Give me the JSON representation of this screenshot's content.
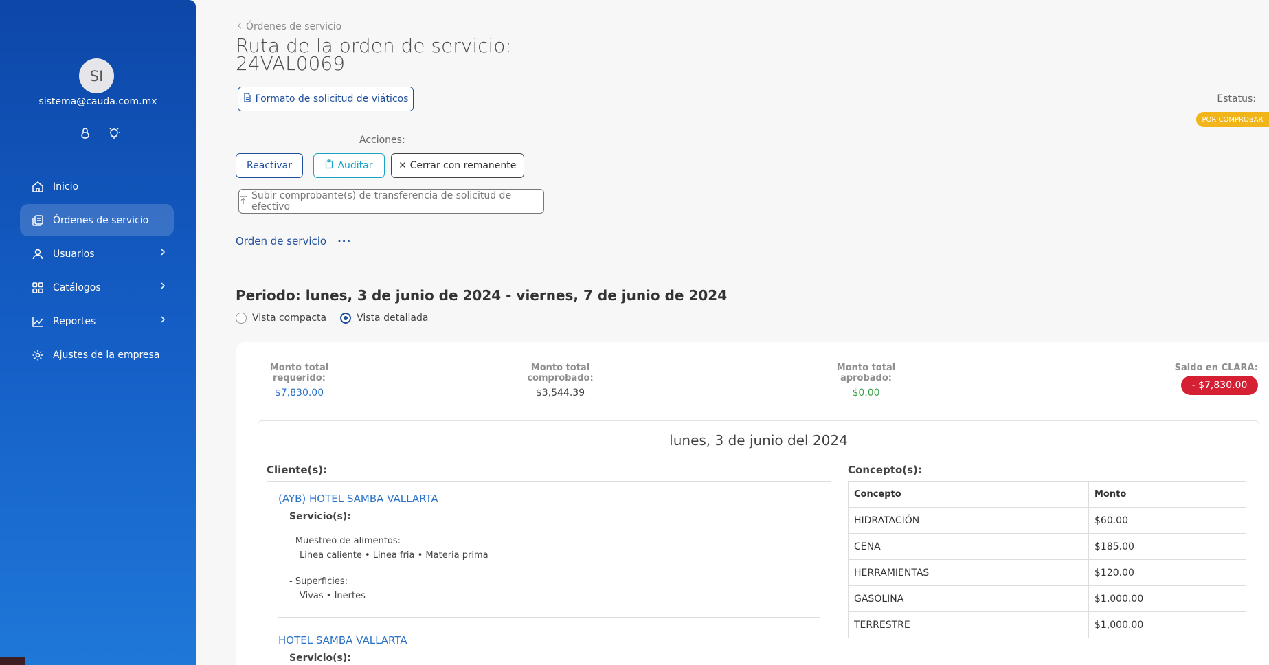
{
  "sidebar": {
    "avatar_initials": "SI",
    "email": "sistema@cauda.com.mx",
    "user_icons": [
      "lock-icon",
      "lightbulb-icon"
    ],
    "items": [
      {
        "label": "Inicio",
        "icon": "home-icon",
        "active": false,
        "has_submenu": false
      },
      {
        "label": "Órdenes de servicio",
        "icon": "orders-icon",
        "active": true,
        "has_submenu": false
      },
      {
        "label": "Usuarios",
        "icon": "user-icon",
        "active": false,
        "has_submenu": true
      },
      {
        "label": "Catálogos",
        "icon": "grid-icon",
        "active": false,
        "has_submenu": true
      },
      {
        "label": "Reportes",
        "icon": "chart-icon",
        "active": false,
        "has_submenu": true
      },
      {
        "label": "Ajustes de la empresa",
        "icon": "gear-icon",
        "active": false,
        "has_submenu": false
      }
    ]
  },
  "header": {
    "breadcrumb": "Órdenes de servicio",
    "title_line1": "Ruta de la orden de servicio:",
    "title_line2": "24VAL0069",
    "viaticos_button": "Formato de solicitud de viáticos",
    "status_label": "Estatus:",
    "status_value": "POR COMPROBAR",
    "status_color": "#f2b519"
  },
  "actions": {
    "label": "Acciones:",
    "reactivar": "Reactivar",
    "auditar": "Auditar",
    "cerrar": "Cerrar con remanente",
    "subir": "Subir comprobante(s) de transferencia de solicitud de efectivo"
  },
  "tabs": {
    "orden": "Orden de servicio",
    "more": "···"
  },
  "periodo": {
    "text": "Periodo: lunes, 3 de junio de 2024 - viernes, 7 de junio de 2024",
    "view_compact": "Vista compacta",
    "view_detailed": "Vista detallada",
    "selected_view": "detailed"
  },
  "summary": {
    "requerido_label": "Monto total requerido:",
    "requerido_value": "$7,830.00",
    "comprobado_label": "Monto total comprobado:",
    "comprobado_value": "$3,544.39",
    "aprobado_label": "Monto total aprobado:",
    "aprobado_value": "$0.00",
    "saldo_label": "Saldo en CLARA:",
    "saldo_value": "- $7,830.00",
    "saldo_color": "#d51f33"
  },
  "day": {
    "title": "lunes, 3 de junio del 2024",
    "clientes_label": "Cliente(s):",
    "conceptos_label": "Concepto(s):",
    "clientes": [
      {
        "name": "(AYB) HOTEL SAMBA VALLARTA",
        "servicios_label": "Servicio(s):",
        "servicios": [
          {
            "title": "- Muestreo de alimentos:",
            "detail": "Linea caliente • Linea fria • Materia prima"
          },
          {
            "title": "- Superficies:",
            "detail": "Vivas • Inertes"
          }
        ]
      },
      {
        "name": "HOTEL SAMBA VALLARTA",
        "servicios_label": "Servicio(s):"
      }
    ],
    "conceptos_headers": [
      "Concepto",
      "Monto"
    ],
    "conceptos": [
      {
        "concepto": "HIDRATACIÓN",
        "monto": "$60.00"
      },
      {
        "concepto": "CENA",
        "monto": "$185.00"
      },
      {
        "concepto": "HERRAMIENTAS",
        "monto": "$120.00"
      },
      {
        "concepto": "GASOLINA",
        "monto": "$1,000.00"
      },
      {
        "concepto": "TERRESTRE",
        "monto": "$1,000.00"
      }
    ]
  }
}
